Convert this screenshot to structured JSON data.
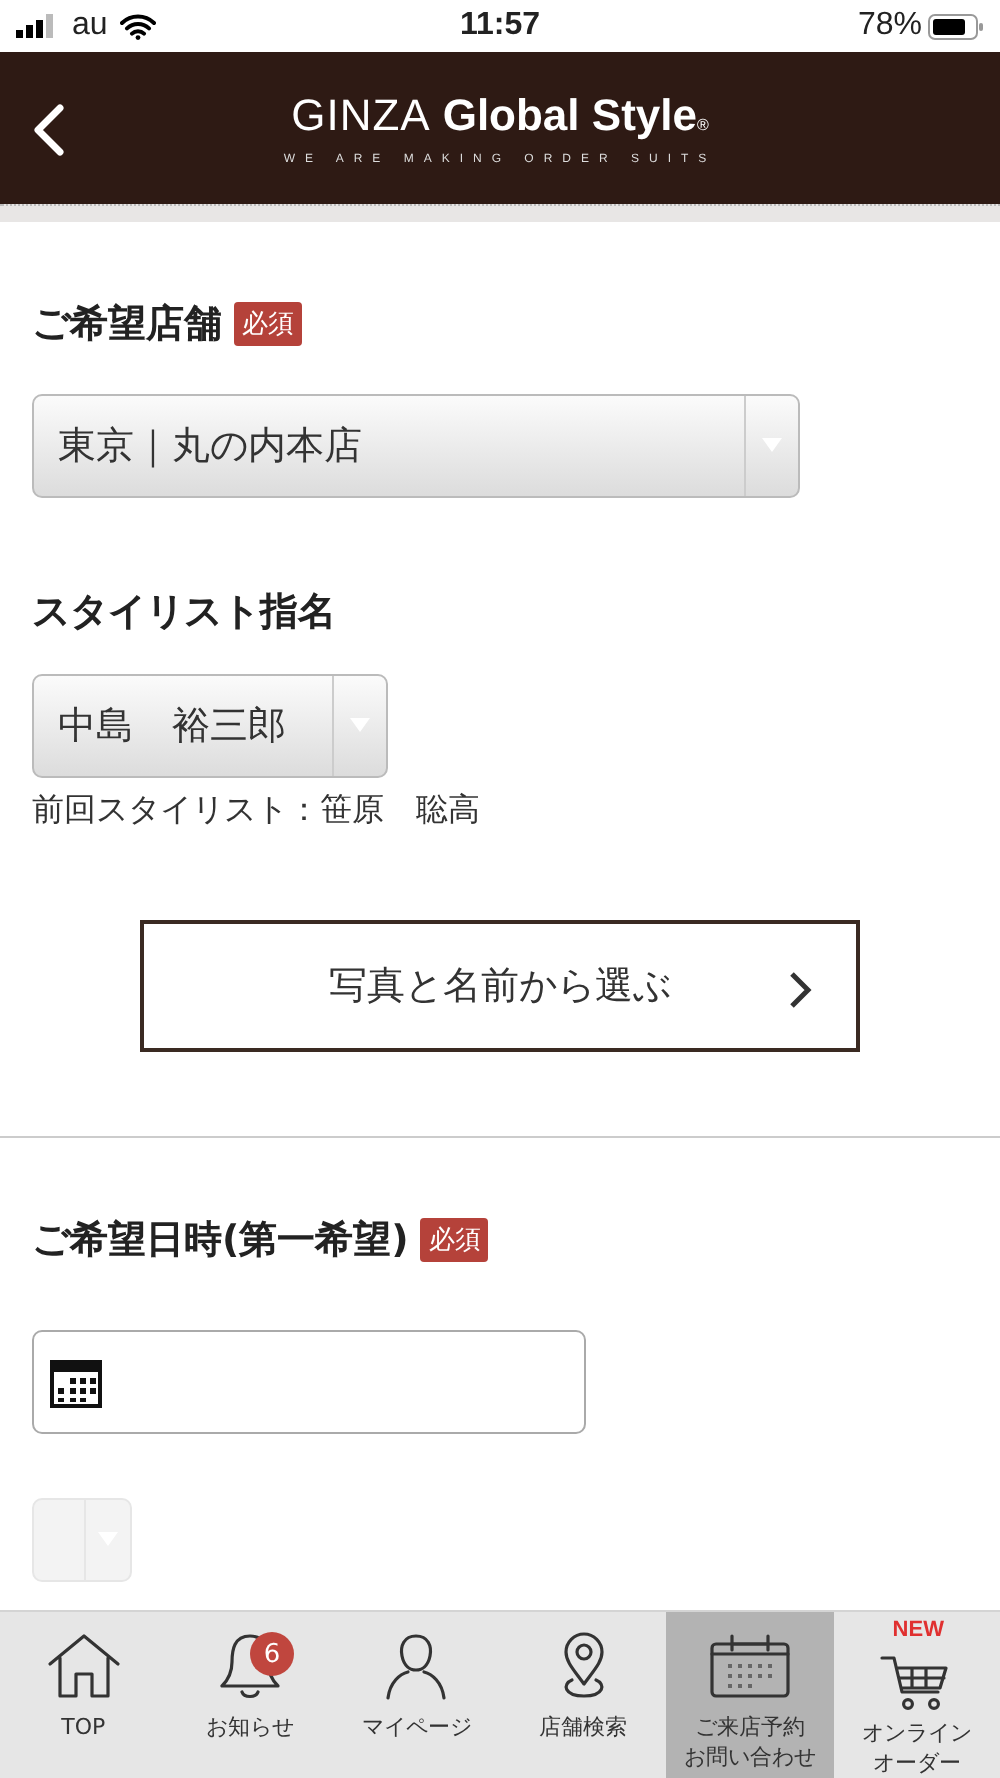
{
  "status_bar": {
    "carrier": "au",
    "time": "11:57",
    "battery": "78%"
  },
  "header": {
    "logo": {
      "light": "GINZA",
      "bold": "Global Style",
      "mark": "®",
      "tagline": "WE ARE MAKING ORDER SUITS"
    }
  },
  "form": {
    "store": {
      "label": "ご希望店舗",
      "required": "必須",
      "value": "東京｜丸の内本店"
    },
    "stylist": {
      "label": "スタイリスト指名",
      "value": "中島　裕三郎",
      "previous": "前回スタイリスト：笹原　聡高",
      "button": "写真と名前から選ぶ"
    },
    "datetime": {
      "label": "ご希望日時(第一希望)",
      "required": "必須"
    }
  },
  "tab_bar": [
    {
      "kind": "home",
      "label": "TOP",
      "selected": false
    },
    {
      "kind": "bell",
      "label": "お知らせ",
      "badge": "6",
      "selected": false
    },
    {
      "kind": "person",
      "label": "マイページ",
      "selected": false
    },
    {
      "kind": "pin",
      "label": "店舗検索",
      "selected": false
    },
    {
      "kind": "calendar",
      "label": [
        "ご来店予約",
        "お問い合わせ"
      ],
      "selected": true
    },
    {
      "kind": "cart",
      "label": [
        "オンライン",
        "オーダー"
      ],
      "new": "NEW",
      "selected": false
    }
  ]
}
